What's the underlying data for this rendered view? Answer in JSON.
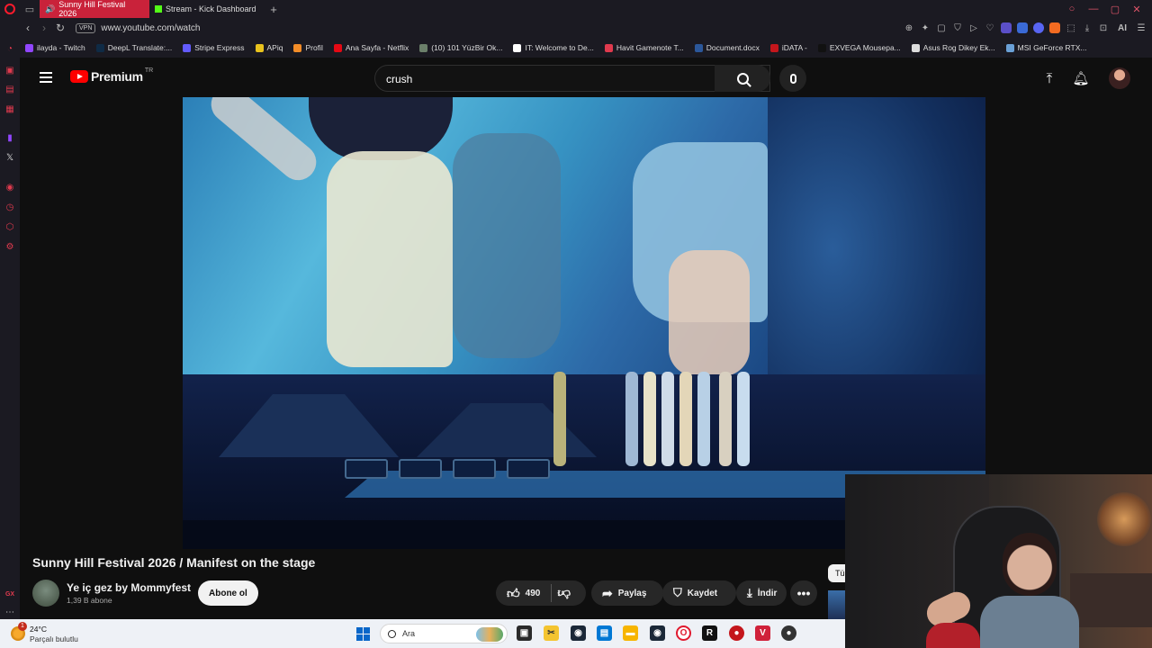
{
  "browser": {
    "tabs": [
      {
        "label": "Sunny Hill Festival 2026",
        "active": true
      },
      {
        "label": "Stream - Kick Dashboard",
        "active": false
      }
    ],
    "vpn_label": "VPN",
    "url": "www.youtube.com/watch",
    "bookmarks": [
      {
        "label": "ilayda - Twitch",
        "color": "#9146ff"
      },
      {
        "label": "DeepL Translate:...",
        "color": "#0f2b46"
      },
      {
        "label": "Stripe Express",
        "color": "#635bff"
      },
      {
        "label": "APiq",
        "color": "#e8c21d"
      },
      {
        "label": "Profil",
        "color": "#f28c28"
      },
      {
        "label": "Ana Sayfa - Netflix",
        "color": "#e50914"
      },
      {
        "label": "(10) 101 YüzBir Ok...",
        "color": "#6b7f6a"
      },
      {
        "label": "IT: Welcome to De...",
        "color": "#ffffff"
      },
      {
        "label": "Havit Gamenote T...",
        "color": "#e03a4e"
      },
      {
        "label": "Document.docx",
        "color": "#2b579a"
      },
      {
        "label": "iDATA -",
        "color": "#c4161c"
      },
      {
        "label": "EXVEGA Mousepa...",
        "color": "#111111"
      },
      {
        "label": "Asus Rog Dikey Ek...",
        "color": "#dddddd"
      },
      {
        "label": "MSI GeForce RTX...",
        "color": "#6aa0d6"
      }
    ],
    "addr_ai_label": "AI"
  },
  "youtube": {
    "logo_text": "Premium",
    "region": "TR",
    "search_value": "crush",
    "video_title": "Sunny Hill Festival 2026 / Manifest on the stage",
    "channel_name": "Ye iç gez by Mommyfest",
    "subscribers": "1,39 B abone",
    "subscribe_label": "Abone ol",
    "likes": "490",
    "share_label": "Paylaş",
    "save_label": "Kaydet",
    "download_label": "İndir",
    "side_chip": "Tü"
  },
  "taskbar": {
    "temperature": "24°C",
    "condition": "Parçalı bulutlu",
    "notification_count": "1",
    "search_placeholder": "Ara"
  }
}
